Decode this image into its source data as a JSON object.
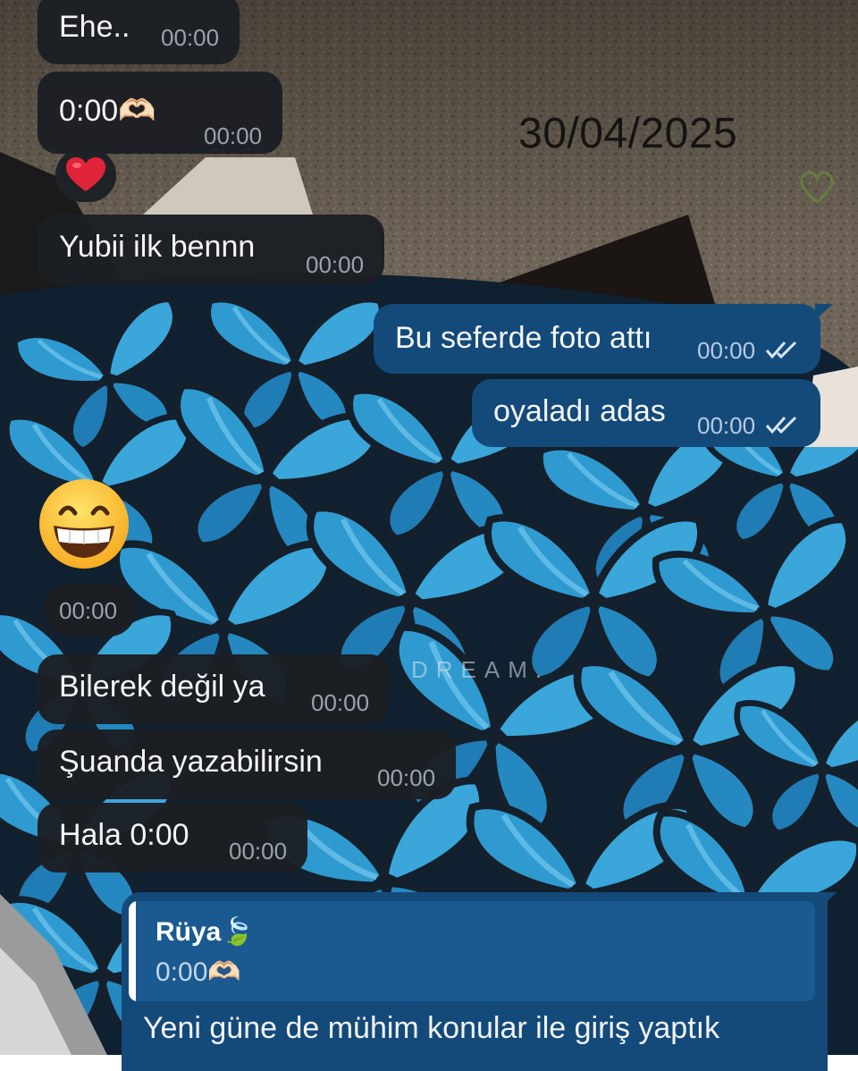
{
  "date_stamp": "30/04/2025",
  "watermark": "DREAM.",
  "colors": {
    "incoming_bubble": "#1c1f24",
    "outgoing_bubble": "#144a7a",
    "reply_bar": "#ffffff"
  },
  "messages": [
    {
      "direction": "incoming",
      "text": "Ehe..",
      "time": "00:00"
    },
    {
      "direction": "incoming",
      "text": "0:00🫶🏻",
      "time": "00:00"
    },
    {
      "direction": "incoming",
      "reaction": "heart-emoji"
    },
    {
      "direction": "incoming",
      "text": "Yubii ilk bennn",
      "time": "00:00"
    },
    {
      "direction": "outgoing",
      "text": "Bu seferde foto attı",
      "time": "00:00",
      "status": "read"
    },
    {
      "direction": "outgoing",
      "text": "oyaladı adas",
      "time": "00:00",
      "status": "read"
    },
    {
      "direction": "incoming",
      "sticker": "grinning-emoji",
      "time": "00:00"
    },
    {
      "direction": "incoming",
      "text": "Bilerek değil ya",
      "time": "00:00"
    },
    {
      "direction": "incoming",
      "text": "Şuanda yazabilirsin",
      "time": "00:00"
    },
    {
      "direction": "incoming",
      "text": "Hala 0:00",
      "time": "00:00"
    }
  ],
  "reply": {
    "quoted_name": "Rüya🍃",
    "quoted_text": "0:00🫶🏻",
    "text": "Yeni güne de mühim konular ile giriş yaptık"
  }
}
